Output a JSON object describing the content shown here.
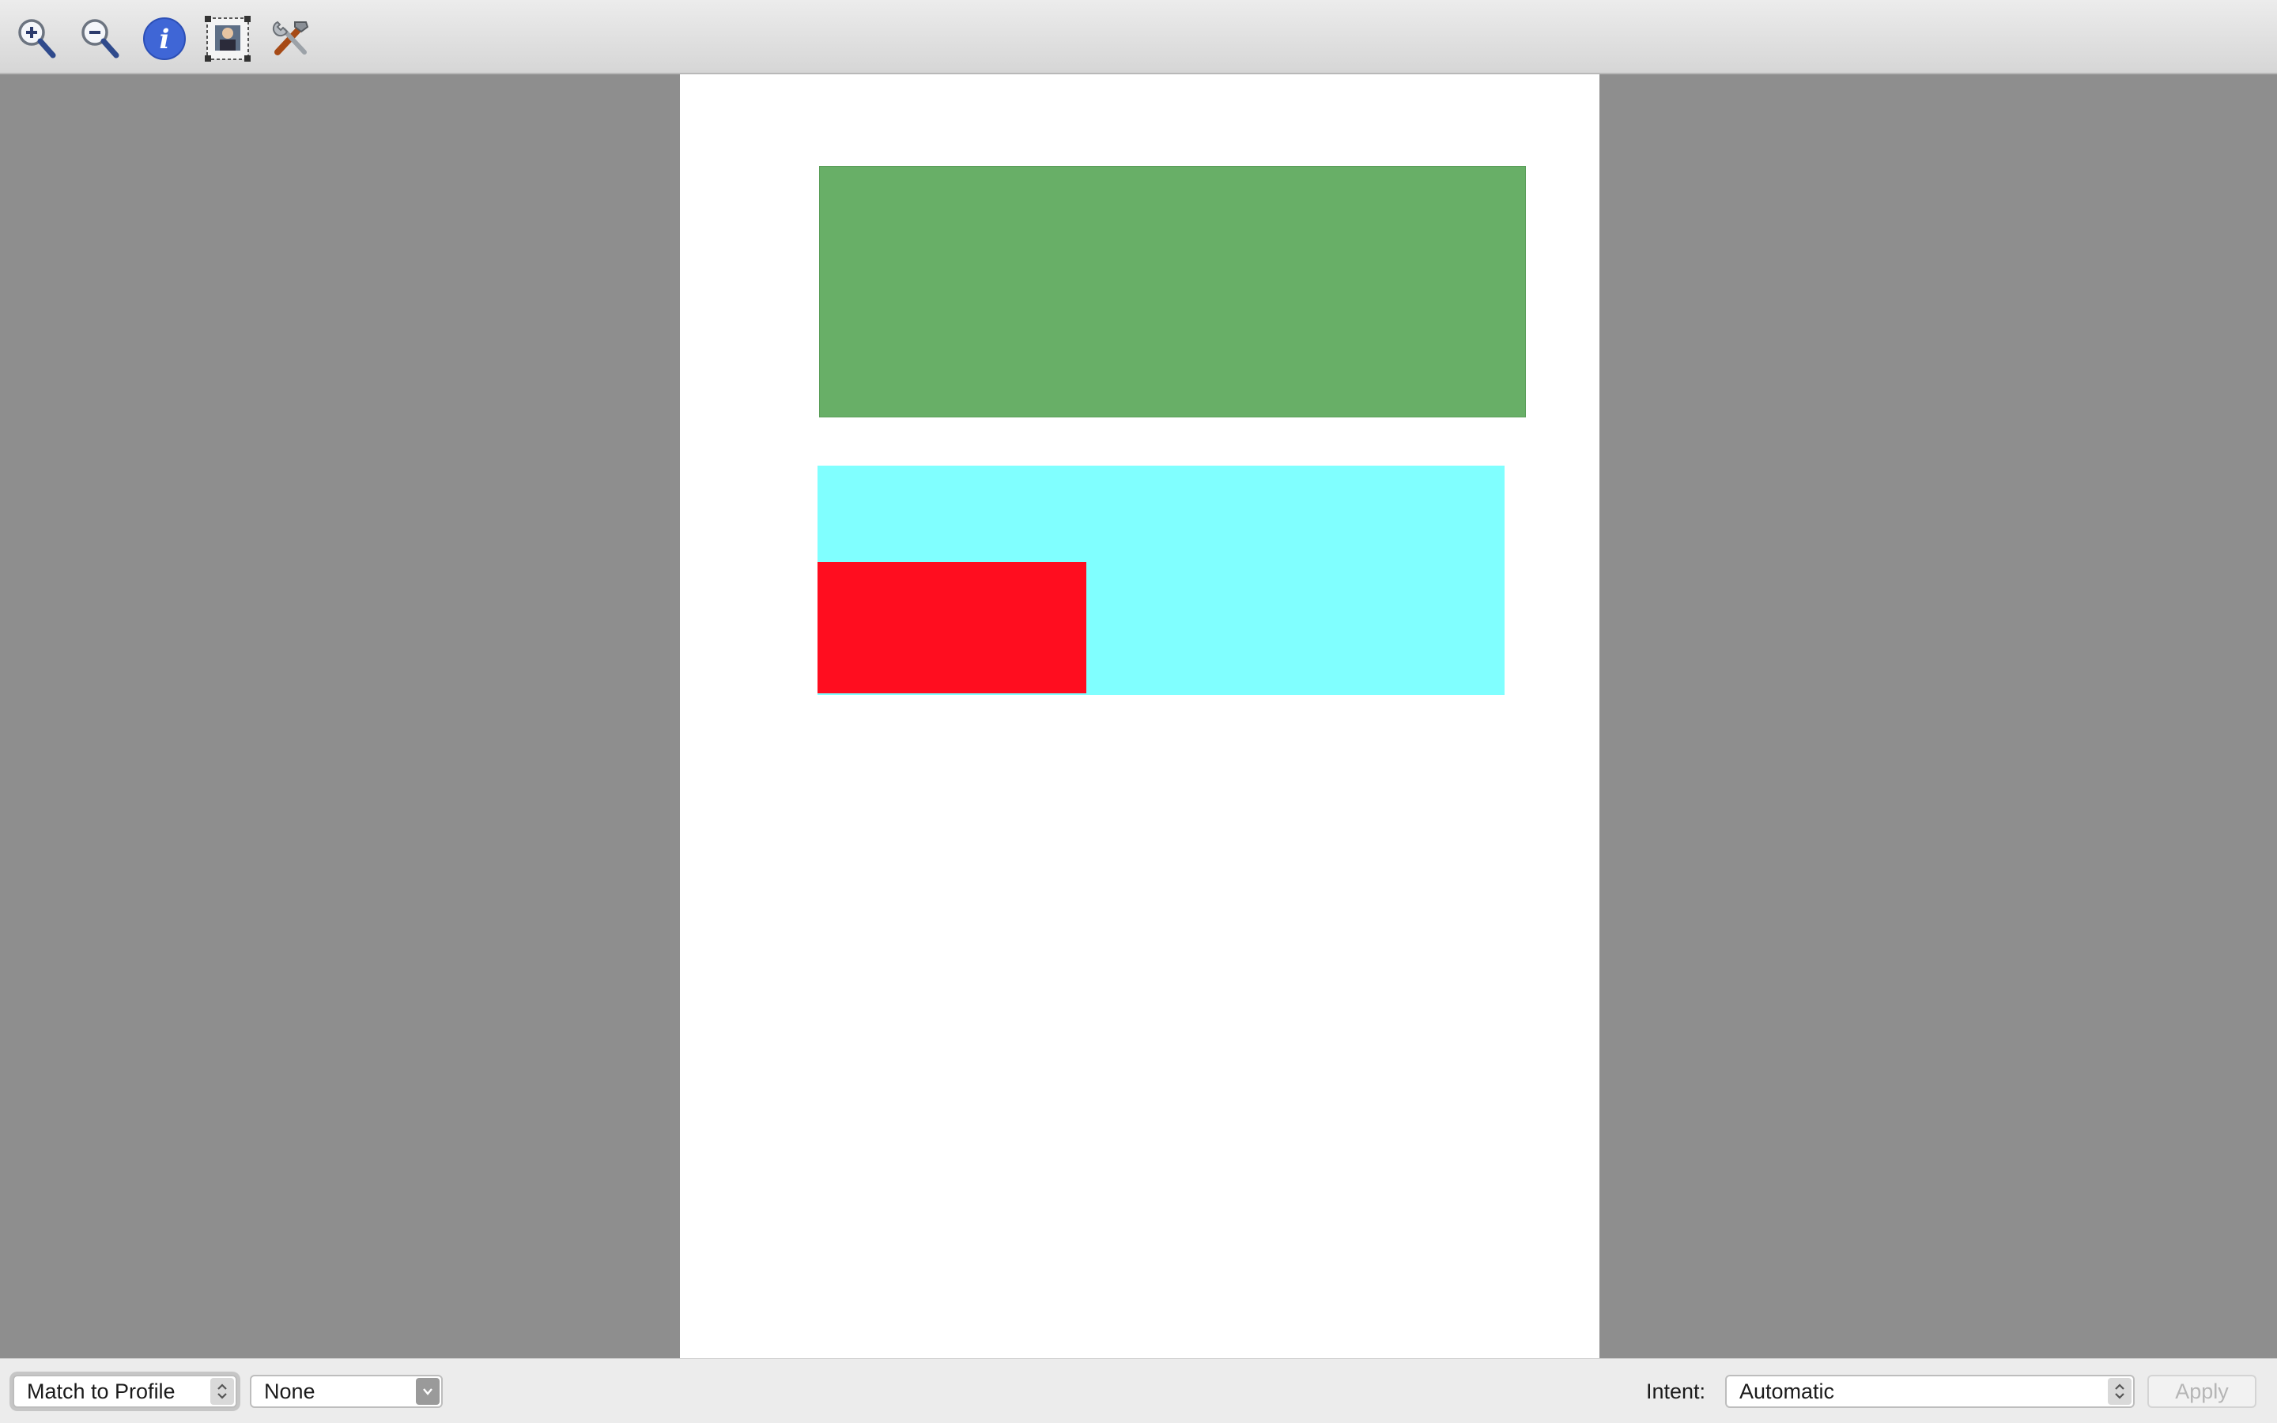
{
  "toolbar": {
    "icons": [
      "zoom-in-icon",
      "zoom-out-icon",
      "info-icon",
      "image-crop-icon",
      "tools-icon"
    ]
  },
  "document": {
    "colors": {
      "page_background": "#ffffff",
      "canvas_background": "#8e8e8e",
      "green_rect": "#68af67",
      "cyan_rect": "#80ffff",
      "red_rect": "#ff0d1f"
    }
  },
  "bottombar": {
    "mode_select": "Match to Profile",
    "profile_select": "None",
    "intent_label": "Intent:",
    "intent_select": "Automatic",
    "apply_label": "Apply"
  }
}
